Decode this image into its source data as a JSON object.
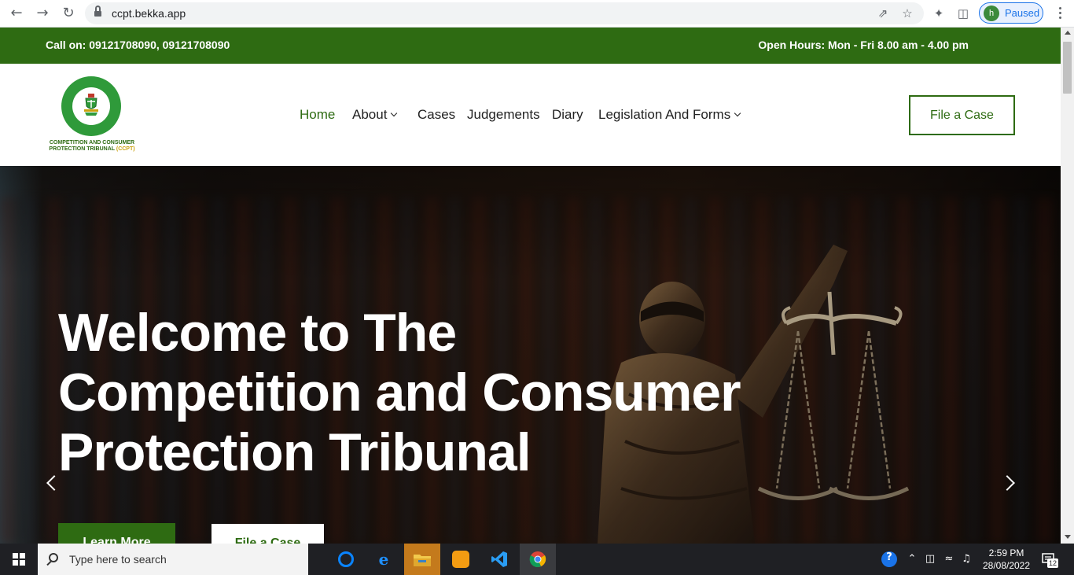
{
  "browser": {
    "url": "ccpt.bekka.app",
    "profile_initial": "h",
    "profile_status": "Paused"
  },
  "topbar": {
    "call": "Call on: 09121708090, 09121708090",
    "hours": "Open Hours: Mon - Fri 8.00 am - 4.00 pm"
  },
  "logo": {
    "line1": "COMPETITION AND CONSUMER",
    "line2": "PROTECTION TRIBUNAL",
    "abbr": "(CCPT)"
  },
  "nav": {
    "items": [
      {
        "label": "Home",
        "active": true
      },
      {
        "label": "About",
        "dropdown": true
      },
      {
        "label": "Cases"
      },
      {
        "label": "Judgements"
      },
      {
        "label": "Diary"
      },
      {
        "label": "Legislation And Forms",
        "dropdown": true
      }
    ],
    "cta": "File a Case"
  },
  "hero": {
    "title_line1": "Welcome to The",
    "title_line2": "Competition and Consumer",
    "title_line3": "Protection Tribunal",
    "primary_button": "Learn More",
    "secondary_button": "File a Case"
  },
  "taskbar": {
    "search_placeholder": "Type here to search",
    "time": "2:59 PM",
    "date": "28/08/2022",
    "notification_count": "12"
  },
  "colors": {
    "brand_green": "#2e6b12",
    "taskbar": "#1f2024"
  }
}
